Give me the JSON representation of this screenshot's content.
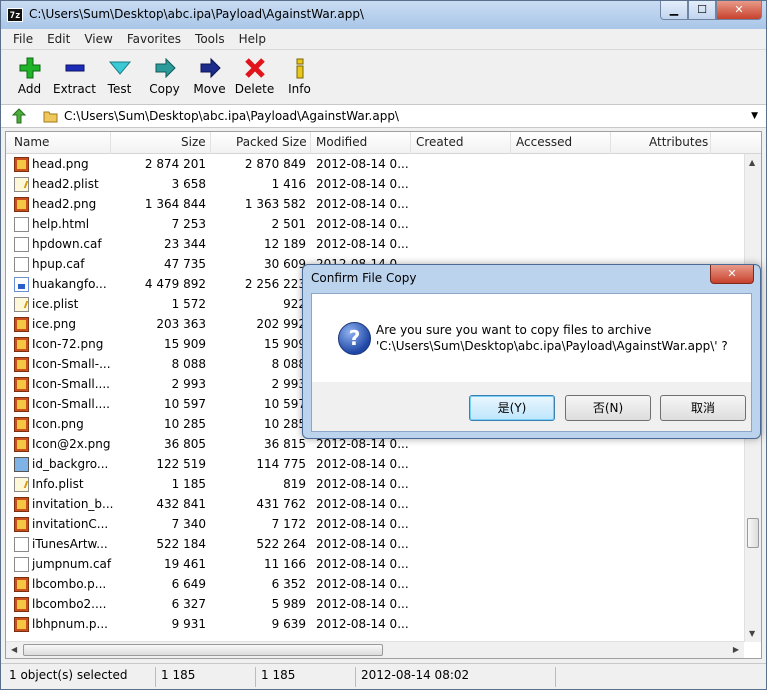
{
  "window": {
    "title": "C:\\Users\\Sum\\Desktop\\abc.ipa\\Payload\\AgainstWar.app\\",
    "app_icon_text": "7z",
    "controls": {
      "minimize": "▁",
      "maximize": "☐",
      "close": "✕"
    }
  },
  "menu": [
    "File",
    "Edit",
    "View",
    "Favorites",
    "Tools",
    "Help"
  ],
  "toolbar": [
    {
      "label": "Add",
      "icon": "add-icon",
      "color": "#1fb32a"
    },
    {
      "label": "Extract",
      "icon": "extract-icon",
      "color": "#1c2bb8"
    },
    {
      "label": "Test",
      "icon": "test-icon",
      "color": "#2ab8c8"
    },
    {
      "label": "Copy",
      "icon": "copy-icon",
      "color": "#2a8c8c"
    },
    {
      "label": "Move",
      "icon": "move-icon",
      "color": "#1c2b8c"
    },
    {
      "label": "Delete",
      "icon": "delete-icon",
      "color": "#e0141a"
    },
    {
      "label": "Info",
      "icon": "info-icon",
      "color": "#d8b81a"
    }
  ],
  "address": {
    "path": "C:\\Users\\Sum\\Desktop\\abc.ipa\\Payload\\AgainstWar.app\\"
  },
  "columns": [
    "Name",
    "Size",
    "Packed Size",
    "Modified",
    "Created",
    "Accessed",
    "Attributes"
  ],
  "files": [
    {
      "name": "head.png",
      "size": "2 874 201",
      "packed": "2 870 849",
      "modified": "2012-08-14 0...",
      "icon": "image"
    },
    {
      "name": "head2.plist",
      "size": "3 658",
      "packed": "1 416",
      "modified": "2012-08-14 0...",
      "icon": "plist"
    },
    {
      "name": "head2.png",
      "size": "1 364 844",
      "packed": "1 363 582",
      "modified": "2012-08-14 0...",
      "icon": "image"
    },
    {
      "name": "help.html",
      "size": "7 253",
      "packed": "2 501",
      "modified": "2012-08-14 0...",
      "icon": "html"
    },
    {
      "name": "hpdown.caf",
      "size": "23 344",
      "packed": "12 189",
      "modified": "2012-08-14 0...",
      "icon": "doc"
    },
    {
      "name": "hpup.caf",
      "size": "47 735",
      "packed": "30 609",
      "modified": "2012-08-14 0...",
      "icon": "doc"
    },
    {
      "name": "huakangfo...",
      "size": "4 479 892",
      "packed": "2 256 223",
      "modified": "2012-08-14 0...",
      "icon": "blue"
    },
    {
      "name": "ice.plist",
      "size": "1 572",
      "packed": "922",
      "modified": "",
      "icon": "plist"
    },
    {
      "name": "ice.png",
      "size": "203 363",
      "packed": "202 992",
      "modified": "",
      "icon": "image"
    },
    {
      "name": "Icon-72.png",
      "size": "15 909",
      "packed": "15 909",
      "modified": "",
      "icon": "image"
    },
    {
      "name": "Icon-Small-...",
      "size": "8 088",
      "packed": "8 088",
      "modified": "",
      "icon": "image"
    },
    {
      "name": "Icon-Small....",
      "size": "2 993",
      "packed": "2 993",
      "modified": "",
      "icon": "image"
    },
    {
      "name": "Icon-Small....",
      "size": "10 597",
      "packed": "10 597",
      "modified": "",
      "icon": "image"
    },
    {
      "name": "Icon.png",
      "size": "10 285",
      "packed": "10 285",
      "modified": "",
      "icon": "image"
    },
    {
      "name": "Icon@2x.png",
      "size": "36 805",
      "packed": "36 815",
      "modified": "2012-08-14 0...",
      "icon": "image"
    },
    {
      "name": "id_backgro...",
      "size": "122 519",
      "packed": "114 775",
      "modified": "2012-08-14 0...",
      "icon": "photo"
    },
    {
      "name": "Info.plist",
      "size": "1 185",
      "packed": "819",
      "modified": "2012-08-14 0...",
      "icon": "plist"
    },
    {
      "name": "invitation_b...",
      "size": "432 841",
      "packed": "431 762",
      "modified": "2012-08-14 0...",
      "icon": "image"
    },
    {
      "name": "invitationC...",
      "size": "7 340",
      "packed": "7 172",
      "modified": "2012-08-14 0...",
      "icon": "image"
    },
    {
      "name": "iTunesArtw...",
      "size": "522 184",
      "packed": "522 264",
      "modified": "2012-08-14 0...",
      "icon": "doc"
    },
    {
      "name": "jumpnum.caf",
      "size": "19 461",
      "packed": "11 166",
      "modified": "2012-08-14 0...",
      "icon": "doc"
    },
    {
      "name": "lbcombo.p...",
      "size": "6 649",
      "packed": "6 352",
      "modified": "2012-08-14 0...",
      "icon": "image"
    },
    {
      "name": "lbcombo2....",
      "size": "6 327",
      "packed": "5 989",
      "modified": "2012-08-14 0...",
      "icon": "image"
    },
    {
      "name": "lbhpnum.p...",
      "size": "9 931",
      "packed": "9 639",
      "modified": "2012-08-14 0...",
      "icon": "image"
    }
  ],
  "status": {
    "selected": "1 object(s) selected",
    "size": "1 185",
    "packed": "1 185",
    "modified": "2012-08-14 08:02"
  },
  "dialog": {
    "title": "Confirm File Copy",
    "close": "✕",
    "line1": "Are you sure you want to copy files to archive",
    "line2": "'C:\\Users\\Sum\\Desktop\\abc.ipa\\Payload\\AgainstWar.app\\' ?",
    "yes": "是(Y)",
    "no": "否(N)",
    "cancel": "取消",
    "icon": "question-icon"
  }
}
